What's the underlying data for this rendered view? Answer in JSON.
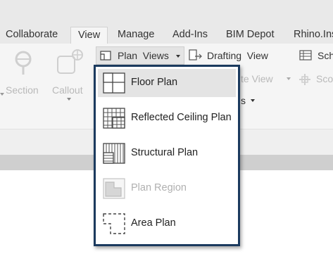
{
  "tabs": [
    {
      "label": "Collaborate"
    },
    {
      "label": "View"
    },
    {
      "label": "Manage"
    },
    {
      "label": "Add-Ins"
    },
    {
      "label": "BIM Depot"
    },
    {
      "label": "Rhino.Ins"
    }
  ],
  "ribbon": {
    "section_label": "Section",
    "callout_label": "Callout",
    "plan_views_label": "Plan  Views",
    "drafting_view_label": "Drafting  View",
    "schedules_label": "Sch",
    "duplicate_view_partial": "te  View",
    "scope_box_partial": "Sco",
    "legends_partial": "s"
  },
  "menu": {
    "items": [
      {
        "label": "Floor Plan",
        "icon": "floor-plan-icon",
        "highlighted": true,
        "disabled": false
      },
      {
        "label": "Reflected Ceiling Plan",
        "icon": "reflected-ceiling-plan-icon",
        "highlighted": false,
        "disabled": false
      },
      {
        "label": "Structural Plan",
        "icon": "structural-plan-icon",
        "highlighted": false,
        "disabled": false
      },
      {
        "label": "Plan Region",
        "icon": "plan-region-icon",
        "highlighted": false,
        "disabled": true
      },
      {
        "label": "Area Plan",
        "icon": "area-plan-icon",
        "highlighted": false,
        "disabled": false
      }
    ]
  },
  "colors": {
    "menu_border": "#1b3a5e",
    "highlight": "#e4e4e4",
    "disabled_text": "#b0b0b0"
  }
}
